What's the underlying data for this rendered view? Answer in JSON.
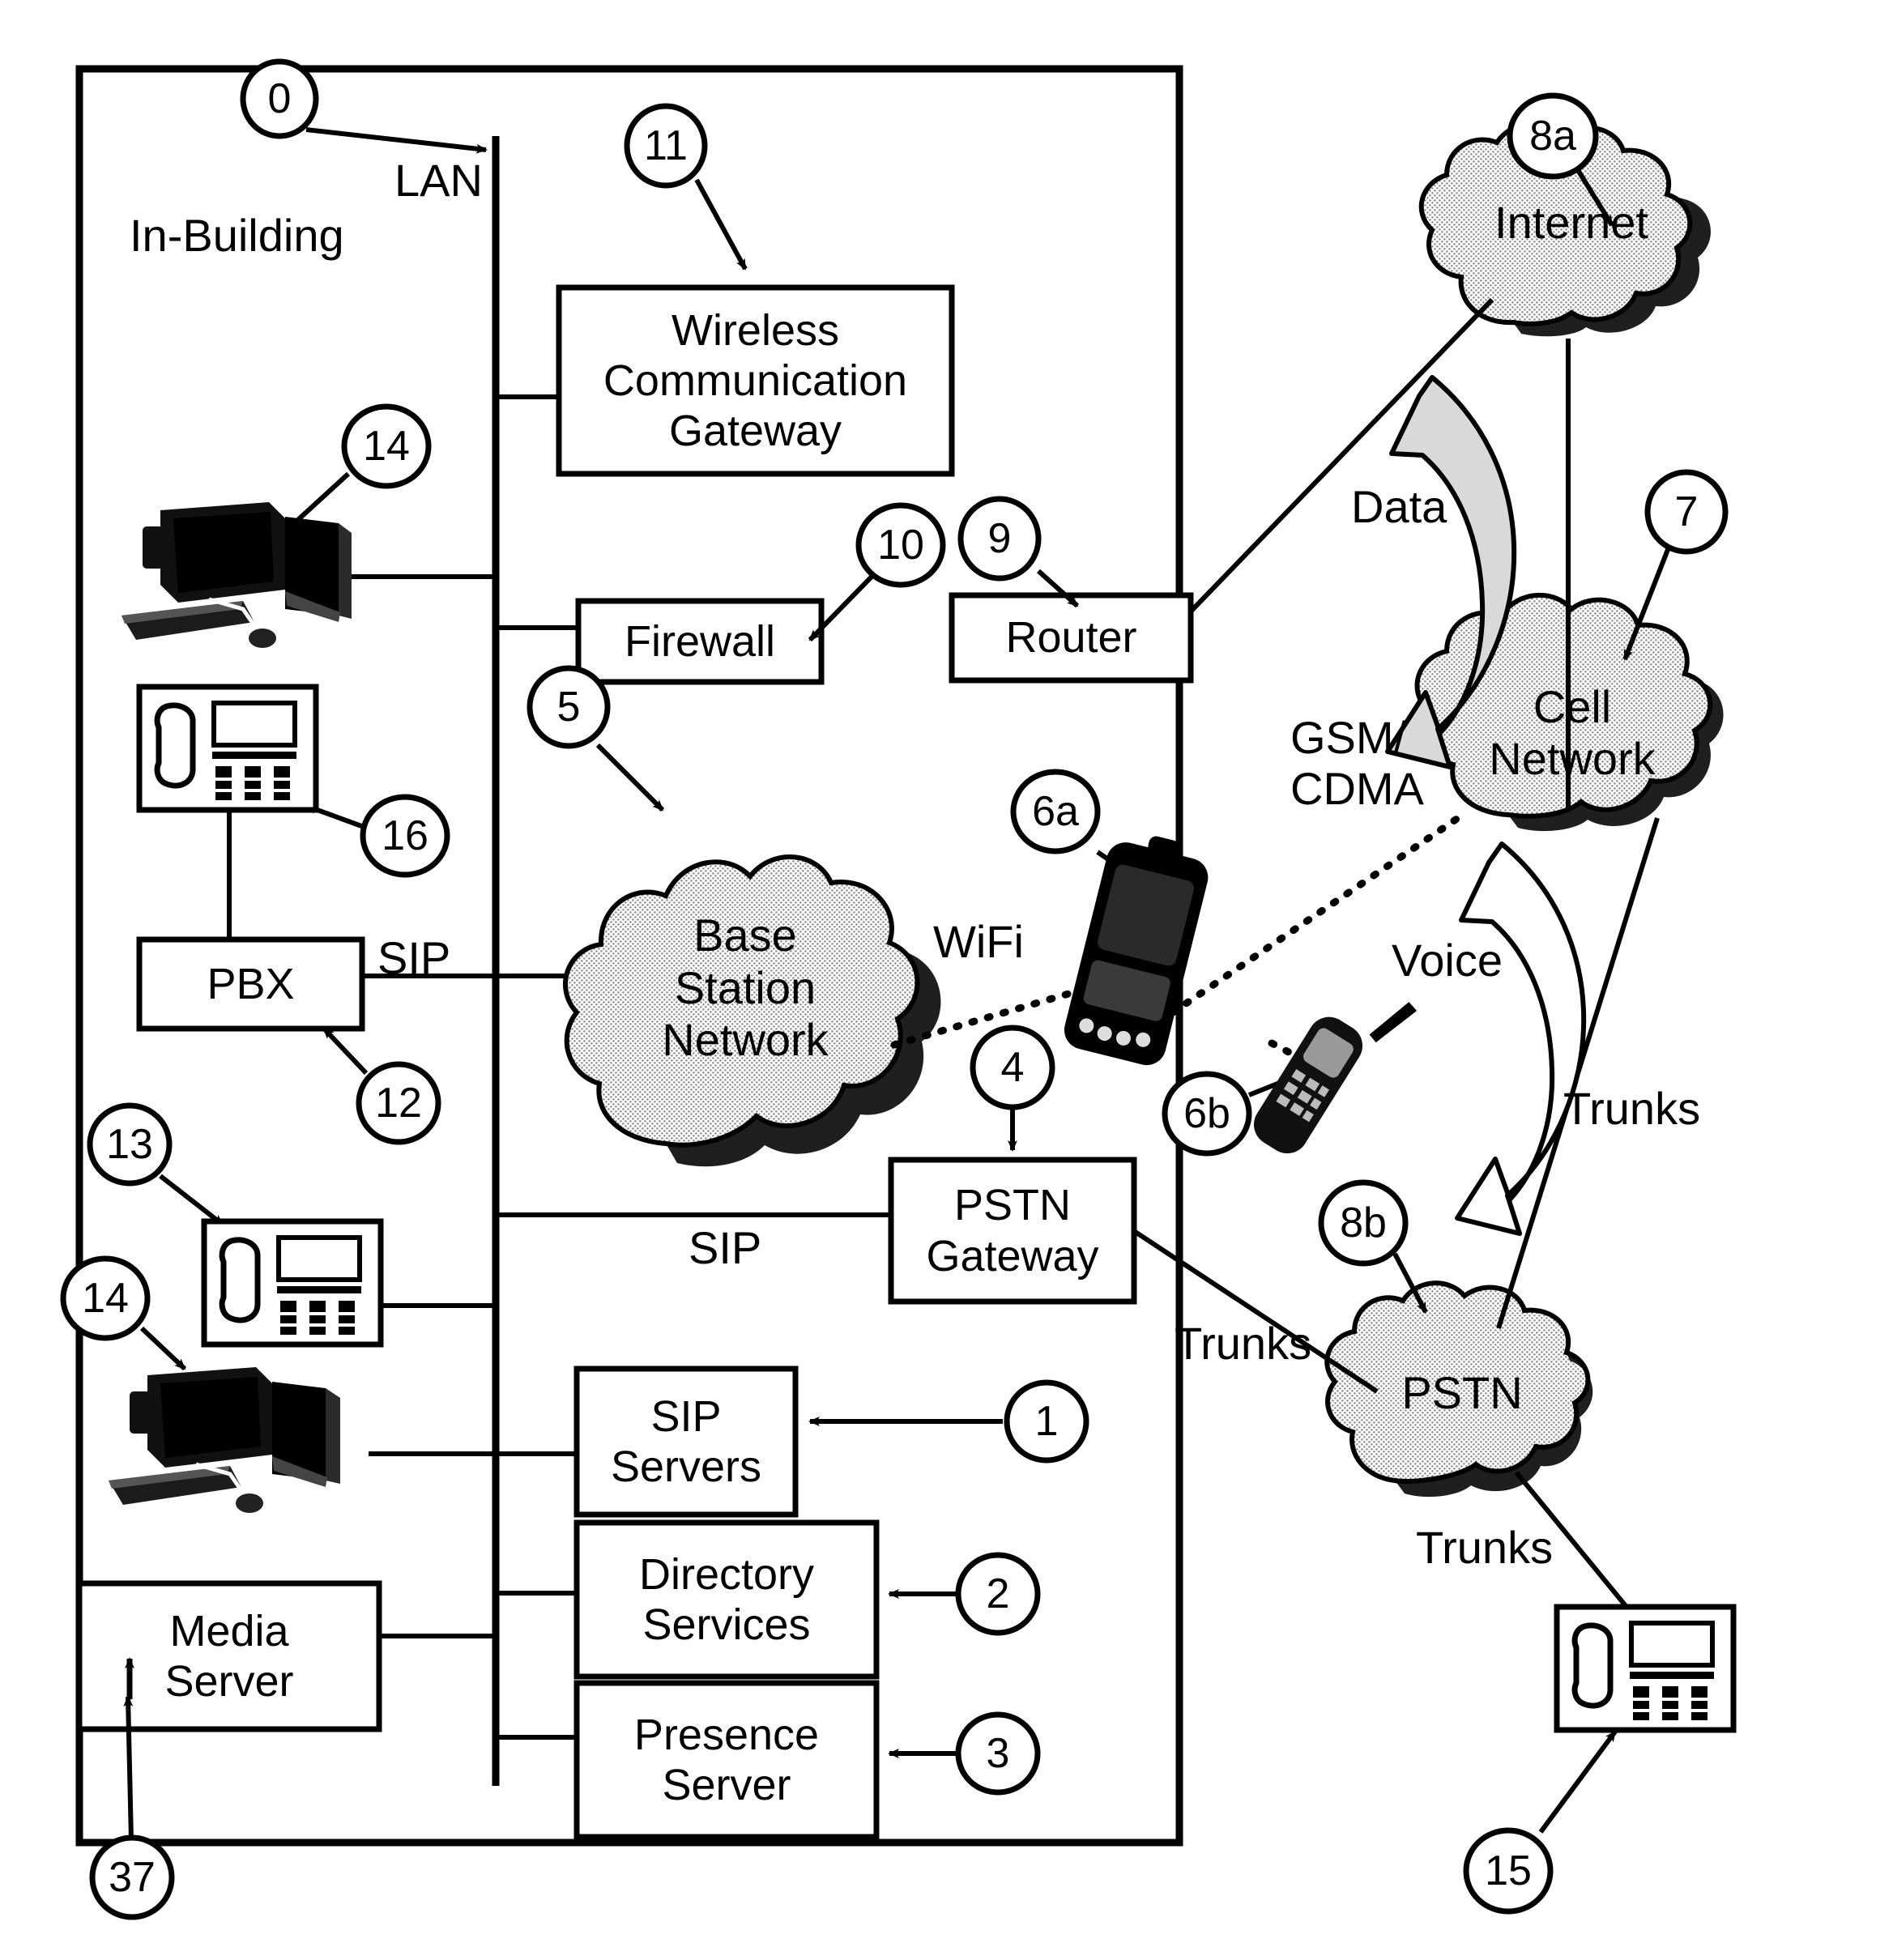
{
  "figure": {
    "title": "In-Building",
    "frame_label": "In-Building"
  },
  "network_labels": {
    "lan": "LAN",
    "sip_pbx": "SIP",
    "sip_gateway": "SIP",
    "wifi": "WiFi",
    "gsm_cdma": "GSM/\nCDMA",
    "data": "Data",
    "voice": "Voice",
    "trunks_gateway": "Trunks",
    "trunks_cell": "Trunks",
    "trunks_phone": "Trunks"
  },
  "boxes": [
    {
      "id": "wireless-gateway",
      "label": "Wireless\nCommunication\nGateway",
      "ref": "11"
    },
    {
      "id": "firewall",
      "label": "Firewall",
      "ref": "10"
    },
    {
      "id": "router",
      "label": "Router",
      "ref": "9"
    },
    {
      "id": "pstn-gateway",
      "label": "PSTN\nGateway",
      "ref": "4"
    },
    {
      "id": "sip-servers",
      "label": "SIP\nServers",
      "ref": "1"
    },
    {
      "id": "directory-services",
      "label": "Directory\nServices",
      "ref": "2"
    },
    {
      "id": "presence-server",
      "label": "Presence\nServer",
      "ref": "3"
    },
    {
      "id": "pbx",
      "label": "PBX",
      "ref": "12"
    },
    {
      "id": "media-server",
      "label": "Media\nServer",
      "ref": "37"
    }
  ],
  "clouds": [
    {
      "id": "internet",
      "label": "Internet",
      "ref": "8a"
    },
    {
      "id": "cell-network",
      "label": "Cell\nNetwork",
      "ref": "7"
    },
    {
      "id": "base-station-network",
      "label": "Base\nStation\nNetwork",
      "ref": "5"
    },
    {
      "id": "pstn",
      "label": "PSTN",
      "ref": "8b"
    }
  ],
  "devices": [
    {
      "id": "desktop-computer-top",
      "type": "computer",
      "ref": "14"
    },
    {
      "id": "desktop-computer-bottom",
      "type": "computer",
      "ref": "14"
    },
    {
      "id": "desk-phone-top",
      "type": "ip-phone",
      "ref": "16"
    },
    {
      "id": "desk-phone-bottom",
      "type": "ip-phone",
      "ref": "13"
    },
    {
      "id": "desk-phone-pstn",
      "type": "ip-phone",
      "ref": "15"
    },
    {
      "id": "smartphone-pda",
      "type": "dual-mode-handset",
      "ref": "6a"
    },
    {
      "id": "cell-phone",
      "type": "cell-phone",
      "ref": "6b"
    }
  ],
  "reference_numerals": {
    "lan_bus": "0",
    "sip_servers": "1",
    "directory_services": "2",
    "presence_server": "3",
    "pstn_gateway": "4",
    "base_station_network": "5",
    "dual_mode_handset": "6a",
    "cell_phone": "6b",
    "cell_network": "7",
    "internet": "8a",
    "pstn": "8b",
    "router": "9",
    "firewall": "10",
    "wireless_gateway": "11",
    "pbx": "12",
    "desk_phone_bottom": "13",
    "computer_top": "14",
    "computer_bottom": "14",
    "pstn_desk_phone": "15",
    "desk_phone_top": "16",
    "media_server": "37"
  },
  "colors": {
    "stroke": "#000000",
    "cloud_fill": "#cccccc",
    "background": "#ffffff",
    "arrow_fill": "#d9d9d9"
  }
}
